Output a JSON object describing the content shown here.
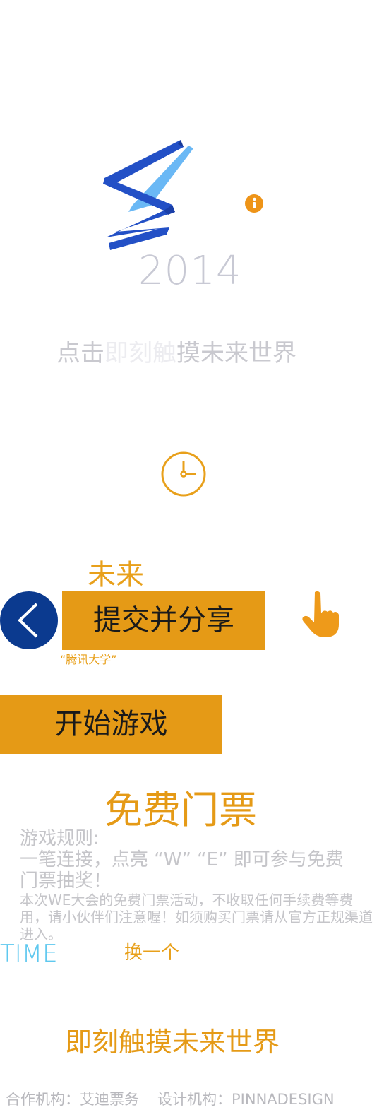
{
  "logo": {
    "year": "2014"
  },
  "icons": {
    "info": "info-icon",
    "clock": "clock-icon",
    "back": "chevron-left-icon",
    "hand": "pointing-hand-icon"
  },
  "tagline": {
    "seg_a": "点击",
    "seg_b": "即刻触",
    "seg_c": "摸未来世界"
  },
  "future_label": "未来",
  "buttons": {
    "submit_share": "提交并分享",
    "start_game": "开始游戏",
    "switch": "换一个"
  },
  "tencent_university": "“腾讯大学”",
  "free_ticket": "免费门票",
  "rules": {
    "title": "游戏规则:",
    "line1": "一笔连接，点亮 “W” “E” 即可参与免费",
    "line2": "门票抽奖！",
    "notice": "本次WE大会的免费门票活动，不收取任何手续费等费用，请小伙伴们注意喔！如须购买门票请从官方正规渠道进入。"
  },
  "time_label": "TIME",
  "bottom_slogan": "即刻触摸未来世界",
  "footer": {
    "partner": "合作机构：艾迪票务",
    "designer": "设计机构：PINNADESIGN"
  },
  "colors": {
    "accent_orange": "#e59a16",
    "navy": "#0b3a8f",
    "logo_blue": "#2a5fcf",
    "logo_light_blue": "#6ab8f5",
    "time_blue": "#5ec8ef",
    "muted_gray": "#c5c5c9"
  }
}
